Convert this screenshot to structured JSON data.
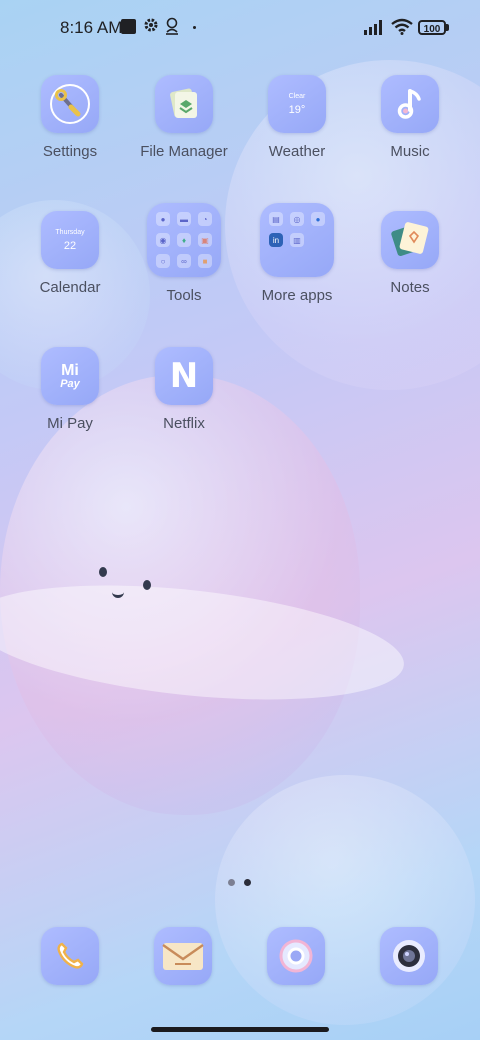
{
  "status_bar": {
    "time": "8:16 AM",
    "battery": "100",
    "icons": [
      "media-square-icon",
      "gear-icon",
      "accessibility-icon",
      "dot-icon",
      "signal-icon",
      "wifi-icon",
      "battery-icon"
    ]
  },
  "apps": {
    "settings": "Settings",
    "file_manager": "File Manager",
    "weather": "Weather",
    "weather_condition": "Clear",
    "weather_temp": "19°",
    "music": "Music",
    "calendar": "Calendar",
    "calendar_day": "Thursday",
    "calendar_date": "22",
    "tools": "Tools",
    "more_apps": "More apps",
    "notes": "Notes",
    "mi_pay": "Mi Pay",
    "mi_pay_logo_top": "Mi",
    "mi_pay_logo_bottom": "Pay",
    "netflix": "Netflix",
    "netflix_logo": "N"
  },
  "dock": {
    "items": [
      "phone-icon",
      "messages-icon",
      "chrome-icon",
      "camera-icon"
    ]
  },
  "pager": {
    "pages": 2,
    "current": 2
  },
  "colors": {
    "icon_tile": "#a3b3fb",
    "label": "#4b5060",
    "status_text": "#202124"
  }
}
